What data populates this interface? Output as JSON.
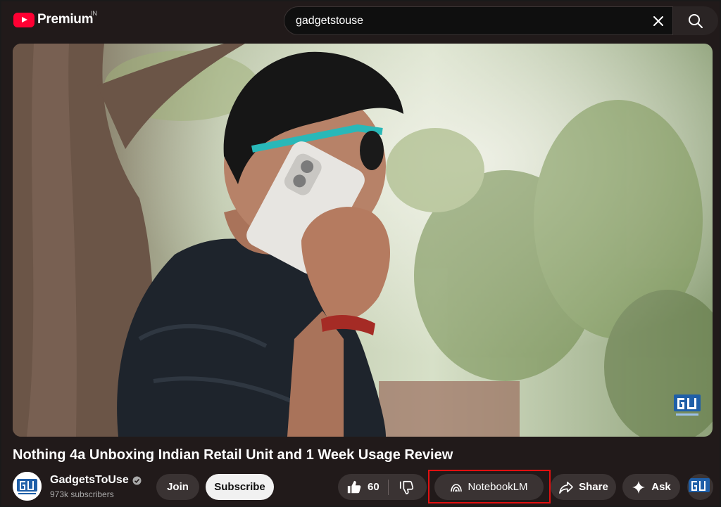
{
  "header": {
    "logo_text": "Premium",
    "country_code": "IN",
    "search_value": "gadgetstouse"
  },
  "video": {
    "title": "Nothing 4a Unboxing Indian Retail Unit and 1 Week Usage Review",
    "watermark_text": "GU"
  },
  "channel": {
    "name": "GadgetsToUse",
    "subscribers": "973k subscribers",
    "avatar_text": "GU"
  },
  "actions": {
    "join_label": "Join",
    "subscribe_label": "Subscribe",
    "like_count": "60",
    "notebook_label": "NotebookLM",
    "share_label": "Share",
    "ask_label": "Ask"
  },
  "colors": {
    "brand_red": "#ff0033",
    "highlight": "#e21010",
    "background": "#211a1a"
  }
}
